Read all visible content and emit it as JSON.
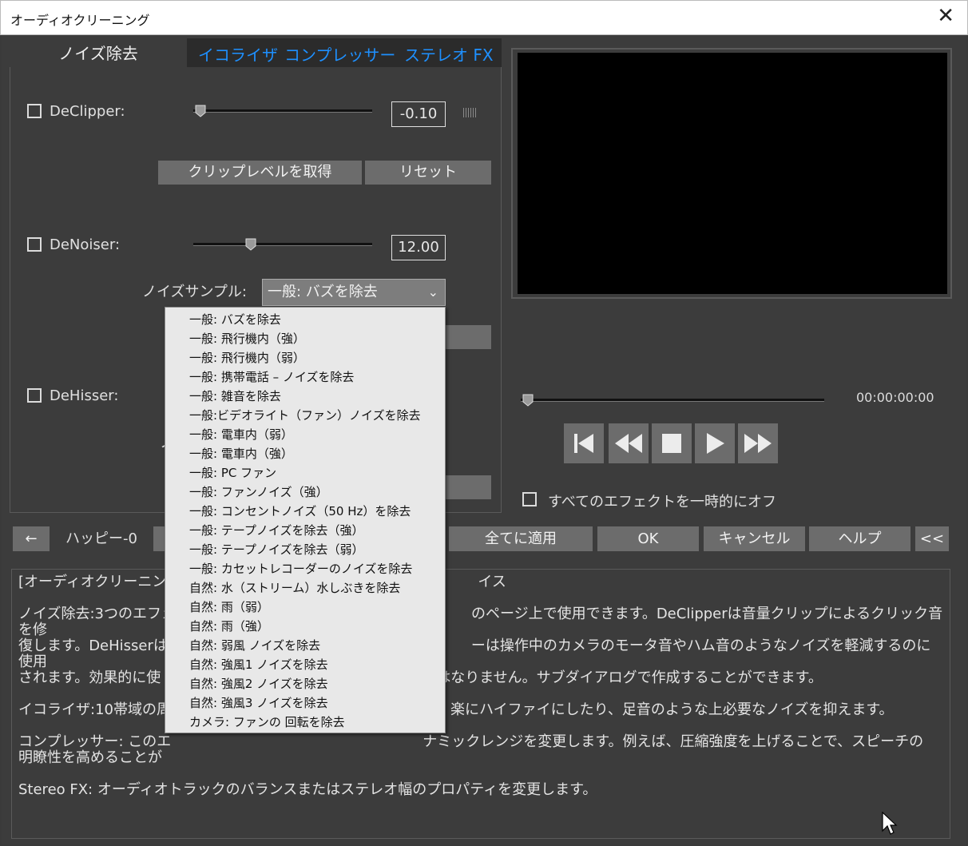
{
  "window": {
    "title": "オーディオクリーニング",
    "close_glyph": "✕"
  },
  "tabs": {
    "active": "ノイズ除去",
    "others": [
      "イコライザ",
      "コンプレッサー",
      "ステレオ FX"
    ]
  },
  "declipper": {
    "label": "DeClipper:",
    "value": "-0.10",
    "slider_level": 0.0,
    "checked": false
  },
  "declipper_buttons": {
    "get_clip_level": "クリップレベルを取得",
    "reset": "リセット"
  },
  "denoiser": {
    "label": "DeNoiser:",
    "value": "12.00",
    "slider_level": 0.3,
    "checked": false
  },
  "noise_sample": {
    "label": "ノイズサンプル:",
    "selected": "一般: バズを除去",
    "chevron": "⌄"
  },
  "dehisser": {
    "label": "DeHisser:",
    "checked": false,
    "partial_label": "ノ"
  },
  "dropdown_options": [
    "一般: バズを除去",
    "一般: 飛行機内（強）",
    "一般: 飛行機内（弱）",
    "一般: 携帯電話 – ノイズを除去",
    "一般:  雑音を除去",
    "一般:ビデオライト（ファン）ノイズを除去",
    "一般: 電車内（弱）",
    "一般: 電車内（強）",
    "一般: PC ファン",
    "一般: ファンノイズ（強）",
    "一般: コンセントノイズ（50 Hz）を除去",
    "一般: テープノイズを除去（強）",
    "一般: テープノイズを除去（弱）",
    "一般: カセットレコーダーのノイズを除去",
    "自然: 水（ストリーム）水しぶきを除去",
    "自然: 雨（弱）",
    "自然: 雨（強）",
    "自然: 弱風 ノイズを除去",
    "自然: 強風1 ノイズを除去",
    "自然: 強風2 ノイズを除去",
    "自然: 強風3 ノイズを除去",
    "カメラ: ファンの 回転を除去"
  ],
  "playback": {
    "timecode": "00:00:00:00",
    "position": 0.0
  },
  "bypass": {
    "label": "すべてのエフェクトを一時的にオフ",
    "checked": false
  },
  "bottom_bar": {
    "back_glyph": "←",
    "preset_name": "ハッピー-0",
    "apply_all": "全てに適用",
    "ok": "OK",
    "cancel": "キャンセル",
    "help": "ヘルプ",
    "collapse": "<<"
  },
  "description": {
    "line1_left": "[オーディオクリーニン",
    "line1_right": "イス",
    "para2_l1_left": "ノイズ除去:3つのエフェ",
    "para2_l1_right": "のページ上で使用できます。DeClipperは音量クリップによるクリック音を修",
    "para2_l2_left": "復します。DeHisserは",
    "para2_l2_right": "ーは操作中のカメラのモータ音やハム音のようなノイズを軽減するのに使用",
    "para2_l3_left": "されます。効果的に使",
    "para2_l3_right": "はなりません。サブダイアログで作成することができます。",
    "para3_left": "イコライザ:10帯域の周",
    "para3_right": "楽にハイファイにしたり、足音のような上必要なノイズを抑えます。",
    "para4_l1_left": "コンプレッサー: このエ",
    "para4_l1_right": "ナミックレンジを変更します。例えば、圧縮強度を上げることで、スピーチの",
    "para4_l2_left": "明瞭性を高めることが",
    "para5": "Stereo FX: オーディオトラックのバランスまたはステレオ幅のプロパティを変更します。"
  },
  "colors": {
    "tab_link": "#1e90ff",
    "panel_bg": "#3c3c3c",
    "button_bg": "#6c6c6c",
    "dropdown_bg": "#e8e8e8"
  }
}
